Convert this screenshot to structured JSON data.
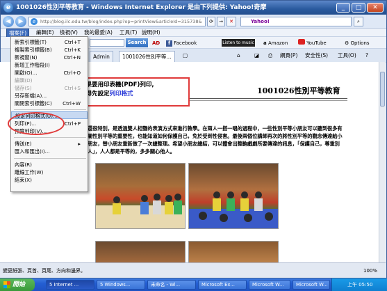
{
  "window": {
    "title": "1001026性別平等教育 - Windows Internet Explorer 是由下列提供: Yahoo!奇摩"
  },
  "address_bar": {
    "url": "http://blog.ilc.edu.tw/blog/index.php?op=printView&articleId=315738&",
    "yahoo_label": "Yahoo!"
  },
  "menu_bar": {
    "items": [
      "檔案(F)",
      "編輯(E)",
      "檢視(V)",
      "我的最愛(A)",
      "工具(T)",
      "說明(H)"
    ]
  },
  "toolbar": {
    "search_label": "Search",
    "facebook_label": "Facebook",
    "listen_label": "Listen to music",
    "amazon_label": "Amazon",
    "youtube_label": "YouTube",
    "options_label": "Options"
  },
  "tabs": {
    "admin_label": "Admin",
    "active_label": "1001026性別平等...",
    "page_tool": "網頁(P)",
    "security_tool": "安全性(S)",
    "tools_tool": "工具(O)"
  },
  "file_menu": {
    "items": [
      {
        "label": "新索引標籤(T)",
        "shortcut": "Ctrl+T",
        "disabled": false
      },
      {
        "label": "複製索引標籤(B)",
        "shortcut": "Ctrl+K",
        "disabled": false
      },
      {
        "label": "新視窗(N)",
        "shortcut": "Ctrl+N",
        "disabled": false
      },
      {
        "label": "新增工作階段(I)",
        "shortcut": "",
        "disabled": false
      },
      {
        "label": "開啟(O)...",
        "shortcut": "Ctrl+O",
        "disabled": false
      },
      {
        "label": "編輯(D)",
        "shortcut": "",
        "disabled": true
      },
      {
        "label": "儲存(S)",
        "shortcut": "Ctrl+S",
        "disabled": true
      },
      {
        "label": "另存新檔(A)...",
        "shortcut": "",
        "disabled": false
      },
      {
        "label": "關閉索引標籤(C)",
        "shortcut": "Ctrl+W",
        "disabled": false
      },
      {
        "label": "設定列印格式(U)...",
        "shortcut": "",
        "disabled": false
      },
      {
        "label": "列印(P)...",
        "shortcut": "Ctrl+P",
        "disabled": false
      },
      {
        "label": "預覽列印(V)...",
        "shortcut": "",
        "disabled": false
      },
      {
        "label": "傳送(E)",
        "shortcut": "",
        "disabled": false
      },
      {
        "label": "匯入和匯出(I)...",
        "shortcut": "",
        "disabled": false
      },
      {
        "label": "內容(R)",
        "shortcut": "",
        "disabled": false
      },
      {
        "label": "離線工作(W)",
        "shortcut": "",
        "disabled": false
      },
      {
        "label": "結束(X)",
        "shortcut": "",
        "disabled": false
      }
    ]
  },
  "page": {
    "title": "1001026性別平等教育",
    "paragraph": "還很特別，是透過雙人相聲的表演方式來進行教學。在兩人一搭一唱的過程中，一些性別平等小朋友可以聽到很多有關性別平等的重要性，也能知道如何保護自己，免於受到性侵害。最後兩個位講師再次的將性別平等的觀念傳達給小朋友，替小朋友重新做了一次總整理。希望小朋友總結，可以體會出整齣戲劇所要傳達的訊息，「保護自己，尊重別人」，人人都是平等的，多多關心他人。"
  },
  "callout": {
    "line1": "如果要用印表機(PDF)列印,",
    "line2_prefix": "記得先設定",
    "line2_highlight": "列印格式"
  },
  "statusbar": {
    "text": "變更紙張、頁首、頁尾、方向和邊界。",
    "zoom": "100%"
  },
  "taskbar": {
    "start_label": "開始",
    "buttons": [
      "5 Internet ...",
      "5 Windows...",
      "未命名 - Wi...",
      "Microsoft Ex...",
      "Microsoft W...",
      "Microsoft W..."
    ],
    "clock": "上午 05:50"
  }
}
